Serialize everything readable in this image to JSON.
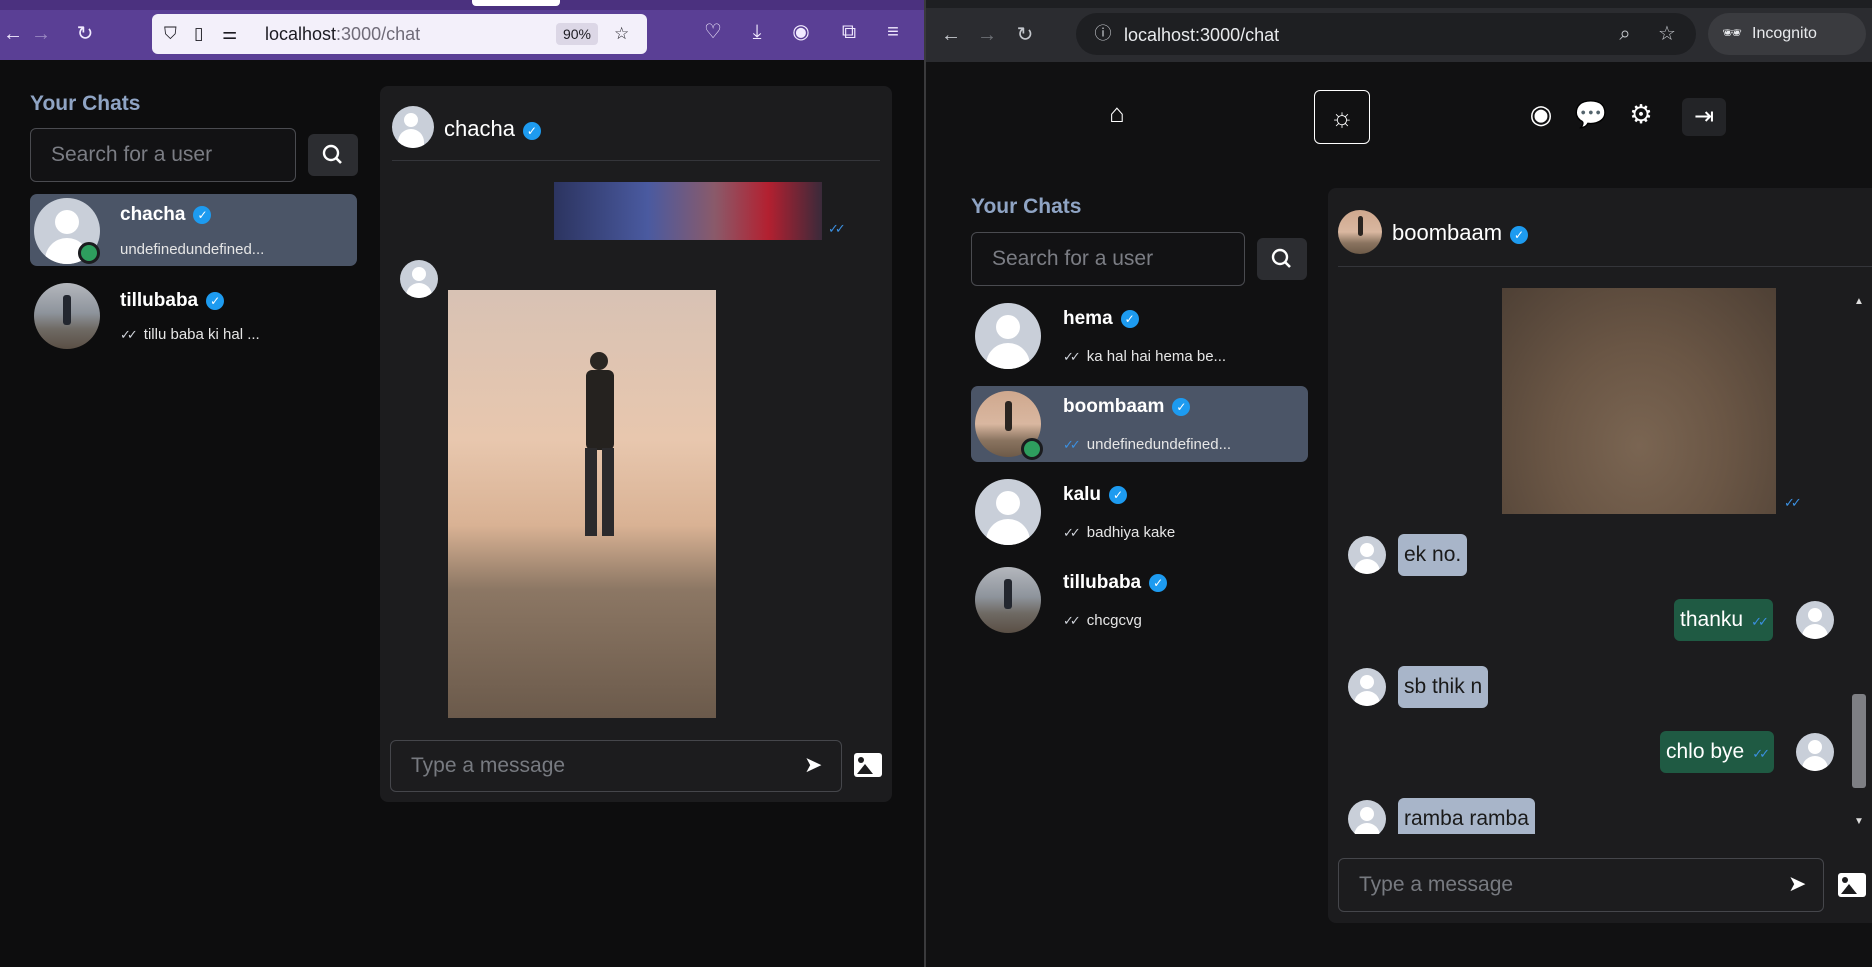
{
  "left_browser": {
    "url_host": "localhost",
    "url_path": ":3000/chat",
    "zoom": "90%"
  },
  "right_browser": {
    "url": "localhost:3000/chat",
    "incognito_label": "Incognito"
  },
  "left_app": {
    "sidebar_title": "Your Chats",
    "search_placeholder": "Search for a user",
    "chats": [
      {
        "name": "chacha",
        "preview": "undefinedundefined...",
        "active": true,
        "online": true
      },
      {
        "name": "tillubaba",
        "preview": "tillu baba ki hal ...",
        "active": false,
        "online": false
      }
    ],
    "conversation": {
      "name": "chacha",
      "input_placeholder": "Type a message"
    }
  },
  "right_app": {
    "sidebar_title": "Your Chats",
    "search_placeholder": "Search for a user",
    "chats": [
      {
        "name": "hema",
        "preview": "ka hal hai hema be..."
      },
      {
        "name": "boombaam",
        "preview": "undefinedundefined..."
      },
      {
        "name": "kalu",
        "preview": "badhiya kake"
      },
      {
        "name": "tillubaba",
        "preview": "chcgcvg"
      }
    ],
    "conversation": {
      "name": "boombaam",
      "messages": [
        {
          "from": "them",
          "text": "ek no."
        },
        {
          "from": "me",
          "text": "thanku"
        },
        {
          "from": "them",
          "text": "sb thik n"
        },
        {
          "from": "me",
          "text": "chlo bye"
        },
        {
          "from": "them",
          "text": "ramba ramba"
        }
      ],
      "input_placeholder": "Type a message"
    }
  },
  "icons": {
    "tick": "✓✓",
    "check": "✓",
    "send": "➤",
    "search": "⌕"
  },
  "colors": {
    "firefox_toolbar": "#5a3f95",
    "active_chat": "#4b5567",
    "verified": "#1d9bf0",
    "online": "#2e9e5e",
    "bubble_in": "#a8b5c9",
    "bubble_out": "#1f5a43"
  }
}
